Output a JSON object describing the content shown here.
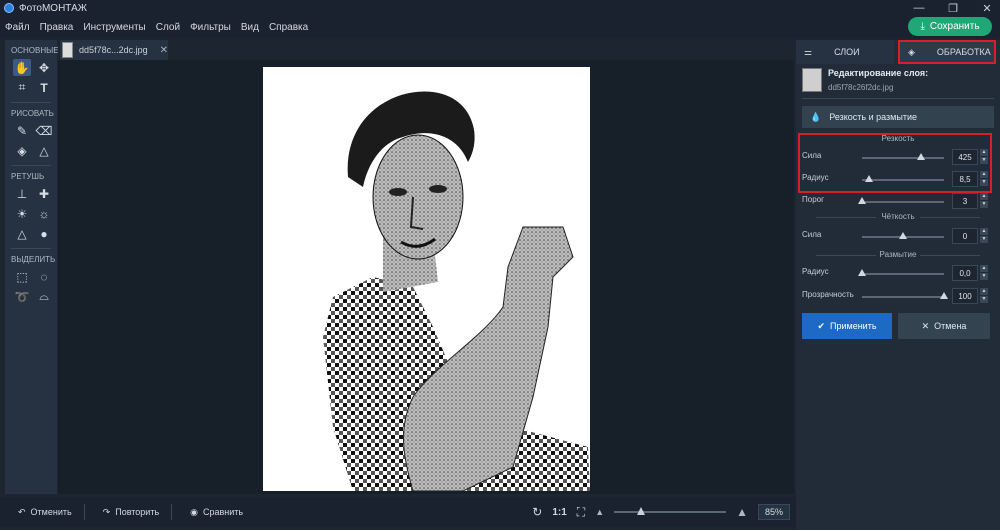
{
  "app": {
    "title": "ФотоМОНТАЖ",
    "window_controls": [
      "—",
      "❐",
      "✕"
    ]
  },
  "menu": [
    "Файл",
    "Правка",
    "Инструменты",
    "Слой",
    "Фильтры",
    "Вид",
    "Справка"
  ],
  "save_button": {
    "label": "Сохранить",
    "color": "#1fa876"
  },
  "toolbox": {
    "sections": [
      {
        "title": "ОСНОВНЫЕ",
        "tools": [
          "hand-tool-icon",
          "move-tool-icon",
          "crop-tool-icon",
          "text-tool-icon"
        ]
      },
      {
        "title": "РИСОВАТЬ",
        "tools": [
          "brush-tool-icon",
          "eraser-tool-icon",
          "fill-tool-icon",
          "shapes-tool-icon"
        ]
      },
      {
        "title": "РЕТУШЬ",
        "tools": [
          "stamp-tool-icon",
          "healing-tool-icon",
          "dodge-tool-icon",
          "burn-tool-icon",
          "sharpen-tool-icon",
          "blur-tool-icon"
        ]
      },
      {
        "title": "ВЫДЕЛИТЬ",
        "tools": [
          "rect-select-icon",
          "ellipse-select-icon",
          "lasso-icon",
          "polygon-lasso-icon"
        ]
      }
    ]
  },
  "document": {
    "tab_name": "dd5f78c...2dc.jpg",
    "close": "✕"
  },
  "bottom": {
    "undo": "Отменить",
    "redo": "Повторить",
    "compare": "Сравнить",
    "ratio": "1:1",
    "zoom": "85%",
    "zoom_level": 0.2
  },
  "panel": {
    "tabs": [
      "СЛОИ",
      "ОБРАБОТКА"
    ],
    "layer_title": "Редактирование слоя:",
    "layer_file": "dd5f78c26f2dc.jpg",
    "filter_button": "Резкость и размытие",
    "groups": [
      {
        "title": "Резкость",
        "params": [
          {
            "label": "Сила",
            "value": "425",
            "pos": 0.72
          },
          {
            "label": "Радиус",
            "value": "8,5",
            "pos": 0.08
          },
          {
            "label": "Порог",
            "value": "3",
            "pos": 0.0
          }
        ]
      },
      {
        "title": "Чёткость",
        "params": [
          {
            "label": "Сила",
            "value": "0",
            "pos": 0.5
          }
        ]
      },
      {
        "title": "Размытие",
        "params": [
          {
            "label": "Радиус",
            "value": "0,0",
            "pos": 0.0
          },
          {
            "label": "Прозрачность",
            "value": "100",
            "pos": 1.0
          }
        ]
      }
    ],
    "apply": "Применить",
    "cancel": "Отмена"
  },
  "colors": {
    "accent": "#1c6ac4",
    "highlight": "#d81e2a"
  }
}
